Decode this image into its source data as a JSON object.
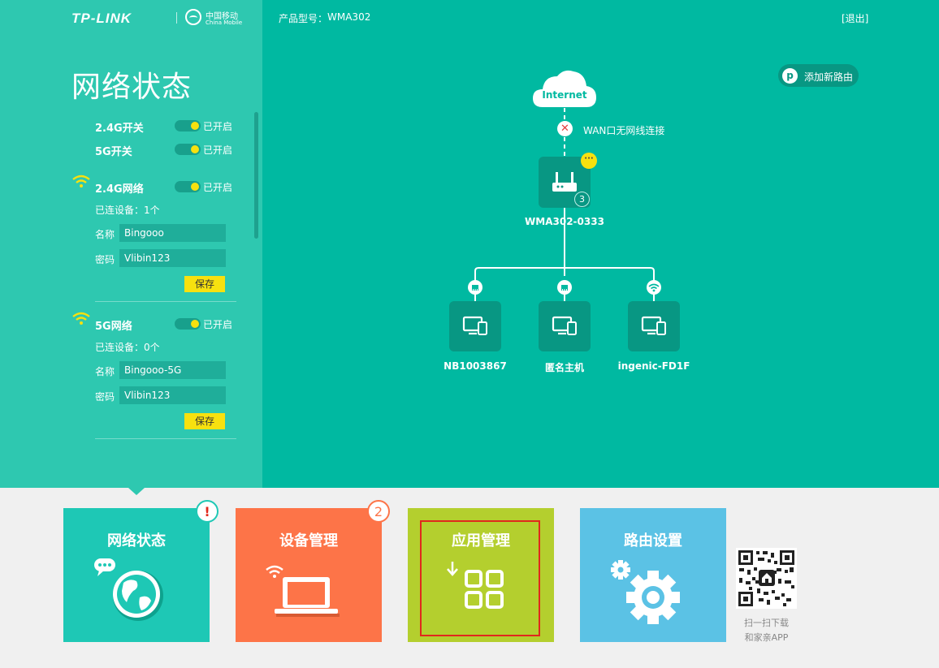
{
  "header": {
    "brand": "TP-LINK",
    "partner_line1": "中国移动",
    "partner_line2": "China Mobile",
    "model_label": "产品型号：",
    "model_value": "WMA302",
    "logout": "[退出]"
  },
  "left_panel": {
    "title": "网络状态",
    "switch_24g": {
      "label": "2.4G开关",
      "state": "已开启"
    },
    "switch_5g": {
      "label": "5G开关",
      "state": "已开启"
    },
    "net_24g": {
      "label": "2.4G网络",
      "state": "已开启",
      "connected": "已连设备：1个",
      "name_label": "名称",
      "name_value": "Bingooo",
      "pwd_label": "密码",
      "pwd_value": "Vlibin123",
      "save": "保存"
    },
    "net_5g": {
      "label": "5G网络",
      "state": "已开启",
      "connected": "已连设备：0个",
      "name_label": "名称",
      "name_value": "Bingooo-5G",
      "pwd_label": "密码",
      "pwd_value": "Vlibin123",
      "save": "保存"
    }
  },
  "add_router": {
    "label": "添加新路由",
    "icon": "tp-link-p-icon"
  },
  "topology": {
    "internet_label": "Internet",
    "wan_status": "WAN口无网线连接",
    "router_name": "WMA302-0333",
    "router_device_count": "3",
    "router_more": "···",
    "devices": [
      {
        "name": "NB1003867",
        "connection": "wired"
      },
      {
        "name": "匿名主机",
        "connection": "wired"
      },
      {
        "name": "ingenic-FD1F",
        "connection": "wireless"
      }
    ]
  },
  "tiles": {
    "status": {
      "label": "网络状态",
      "badge": "!"
    },
    "device": {
      "label": "设备管理",
      "badge": "2"
    },
    "app": {
      "label": "应用管理"
    },
    "router": {
      "label": "路由设置"
    }
  },
  "qr": {
    "line1": "扫一扫下载",
    "line2": "和家亲APP"
  },
  "colors": {
    "teal_main": "#00b9a1",
    "teal_left": "#2ec8b0",
    "yellow": "#f7e10f",
    "tile_status": "#1ec8b5",
    "tile_device": "#fd7448",
    "tile_app": "#b4cf2e",
    "tile_router": "#5bc2e5",
    "highlight_red": "#e0281d"
  }
}
